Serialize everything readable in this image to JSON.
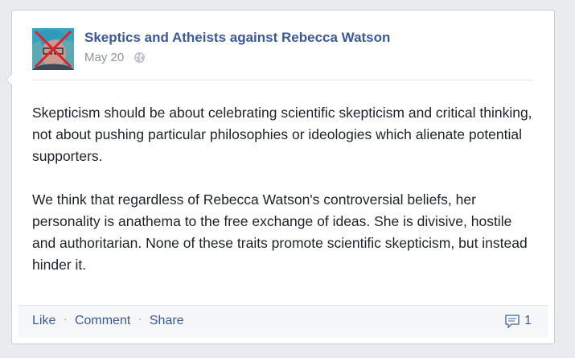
{
  "post": {
    "author": "Skeptics and Atheists against Rebecca Watson",
    "date": "May 20",
    "privacy_icon": "globe-icon",
    "paragraphs": [
      "Skepticism should be about celebrating scientific skepticism and critical thinking, not about pushing particular philosophies or ideologies which alienate potential supporters.",
      "We think that regardless of Rebecca Watson's controversial beliefs, her personality is anathema to the free exchange of ideas. She is divisive, hostile and authoritarian. None of these traits promote scientific skepticism, but instead hinder it."
    ]
  },
  "actions": {
    "like_label": "Like",
    "comment_label": "Comment",
    "share_label": "Share",
    "separator": "·"
  },
  "comments": {
    "icon": "comment-bubble-icon",
    "count": "1"
  },
  "colors": {
    "link": "#3b5998",
    "meta": "#90949c",
    "text": "#1d2129",
    "page_background": "#e9ebee"
  }
}
